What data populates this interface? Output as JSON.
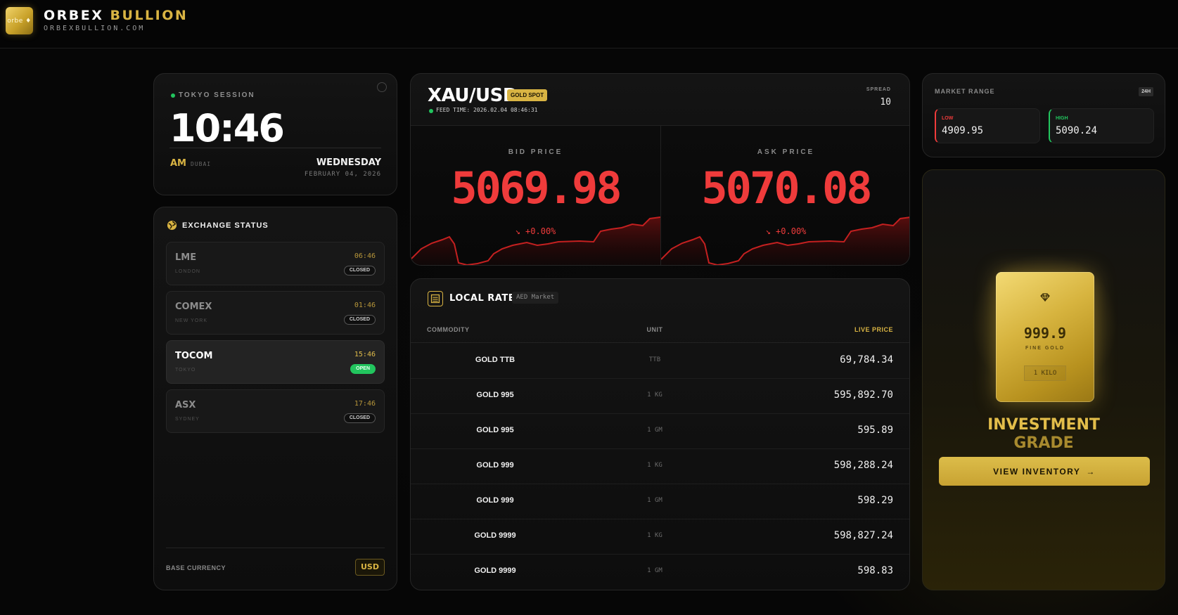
{
  "header": {
    "logo_text": "orbe ♦",
    "brand_primary": "ORBEX",
    "brand_secondary": "BULLION",
    "domain": "ORBEXBULLION.COM"
  },
  "clock": {
    "session": "TOKYO SESSION",
    "time": "10:46",
    "ampm": "AM",
    "city": "DUBAI",
    "weekday": "WEDNESDAY",
    "date": "FEBRUARY 04, 2026"
  },
  "exchange": {
    "title": "EXCHANGE STATUS",
    "items": [
      {
        "name": "LME",
        "city": "LONDON",
        "time": "06:46",
        "status": "CLOSED"
      },
      {
        "name": "COMEX",
        "city": "NEW YORK",
        "time": "01:46",
        "status": "CLOSED"
      },
      {
        "name": "TOCOM",
        "city": "TOKYO",
        "time": "15:46",
        "status": "OPEN"
      },
      {
        "name": "ASX",
        "city": "SYDNEY",
        "time": "17:46",
        "status": "CLOSED"
      }
    ],
    "base_label": "BASE CURRENCY",
    "base_value": "USD"
  },
  "price": {
    "pair": "XAU/USD",
    "badge": "GOLD SPOT",
    "feed_time": "FEED TIME: 2026.02.04 08:46:31",
    "spread_label": "SPREAD",
    "spread_value": "10",
    "bid_label": "BID PRICE",
    "bid_value": "5069.98",
    "bid_change": "+0.00%",
    "ask_label": "ASK PRICE",
    "ask_value": "5070.08",
    "ask_change": "+0.00%"
  },
  "range": {
    "label": "MARKET RANGE",
    "period": "24H",
    "low_label": "LOW",
    "low_value": "4909.95",
    "high_label": "HIGH",
    "high_value": "5090.24"
  },
  "invest": {
    "purity": "999.9",
    "fine": "FINE GOLD",
    "weight": "1 KILO",
    "title_line1": "INVESTMENT",
    "title_line2": "GRADE",
    "button": "VIEW INVENTORY"
  },
  "rates": {
    "title": "LOCAL RATES",
    "tag": "AED Market",
    "col_commodity": "COMMODITY",
    "col_unit": "UNIT",
    "col_price": "LIVE PRICE",
    "rows": [
      {
        "name": "GOLD TTB",
        "unit": "TTB",
        "price": "69,784.34"
      },
      {
        "name": "GOLD 995",
        "unit": "1 KG",
        "price": "595,892.70"
      },
      {
        "name": "GOLD 995",
        "unit": "1 GM",
        "price": "595.89"
      },
      {
        "name": "GOLD 999",
        "unit": "1 KG",
        "price": "598,288.24"
      },
      {
        "name": "GOLD 999",
        "unit": "1 GM",
        "price": "598.29"
      },
      {
        "name": "GOLD 9999",
        "unit": "1 KG",
        "price": "598,827.24"
      },
      {
        "name": "GOLD 9999",
        "unit": "1 GM",
        "price": "598.83"
      }
    ]
  },
  "colors": {
    "gold": "#d9b443",
    "red": "#ef3b3b",
    "green": "#22c55e"
  }
}
